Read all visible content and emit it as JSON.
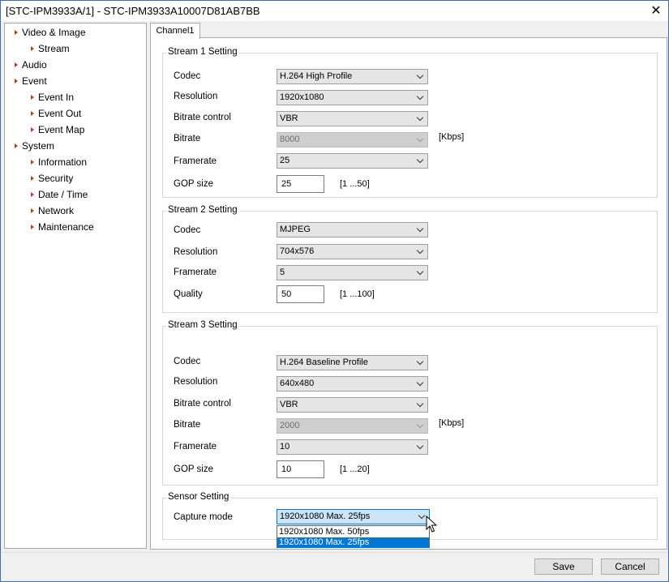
{
  "window": {
    "title": "[STC-IPM3933A/1] - STC-IPM3933A10007D81AB7BB",
    "close_glyph": "✕"
  },
  "tree": {
    "items": [
      {
        "label": "Video & Image",
        "level": 0
      },
      {
        "label": "Stream",
        "level": 1
      },
      {
        "label": "Audio",
        "level": 0
      },
      {
        "label": "Event",
        "level": 0
      },
      {
        "label": "Event In",
        "level": 1
      },
      {
        "label": "Event Out",
        "level": 1
      },
      {
        "label": "Event Map",
        "level": 1
      },
      {
        "label": "System",
        "level": 0
      },
      {
        "label": "Information",
        "level": 1
      },
      {
        "label": "Security",
        "level": 1
      },
      {
        "label": "Date / Time",
        "level": 1
      },
      {
        "label": "Network",
        "level": 1
      },
      {
        "label": "Maintenance",
        "level": 1
      }
    ],
    "arrow_color": "#c0392b"
  },
  "tabs": [
    {
      "label": "Channel1"
    }
  ],
  "stream1": {
    "title": "Stream 1 Setting",
    "codec": {
      "label": "Codec",
      "value": "H.264 High Profile"
    },
    "resolution": {
      "label": "Resolution",
      "value": "1920x1080"
    },
    "bitrate_control": {
      "label": "Bitrate control",
      "value": "VBR"
    },
    "bitrate": {
      "label": "Bitrate",
      "value": "8000",
      "unit": "[Kbps]"
    },
    "framerate": {
      "label": "Framerate",
      "value": "25"
    },
    "gop": {
      "label": "GOP size",
      "value": "25",
      "range": "[1 ...50]"
    }
  },
  "stream2": {
    "title": "Stream 2 Setting",
    "codec": {
      "label": "Codec",
      "value": "MJPEG"
    },
    "resolution": {
      "label": "Resolution",
      "value": "704x576"
    },
    "framerate": {
      "label": "Framerate",
      "value": "5"
    },
    "quality": {
      "label": "Quality",
      "value": "50",
      "range": "[1 ...100]"
    }
  },
  "stream3": {
    "title": "Stream 3 Setting",
    "codec": {
      "label": "Codec",
      "value": "H.264 Baseline Profile"
    },
    "resolution": {
      "label": "Resolution",
      "value": "640x480"
    },
    "bitrate_control": {
      "label": "Bitrate control",
      "value": "VBR"
    },
    "bitrate": {
      "label": "Bitrate",
      "value": "2000",
      "unit": "[Kbps]"
    },
    "framerate": {
      "label": "Framerate",
      "value": "10"
    },
    "gop": {
      "label": "GOP size",
      "value": "10",
      "range": "[1 ...20]"
    }
  },
  "sensor": {
    "title": "Sensor Setting",
    "capture_mode": {
      "label": "Capture mode",
      "value": "1920x1080 Max. 25fps",
      "options": [
        "1920x1080 Max. 50fps",
        "1920x1080 Max. 25fps"
      ],
      "highlighted_option": "1920x1080 Max. 25fps"
    }
  },
  "buttons": {
    "save": "Save",
    "cancel": "Cancel"
  },
  "colors": {
    "accent": "#0078d7",
    "window_border": "#3c6fb4"
  }
}
